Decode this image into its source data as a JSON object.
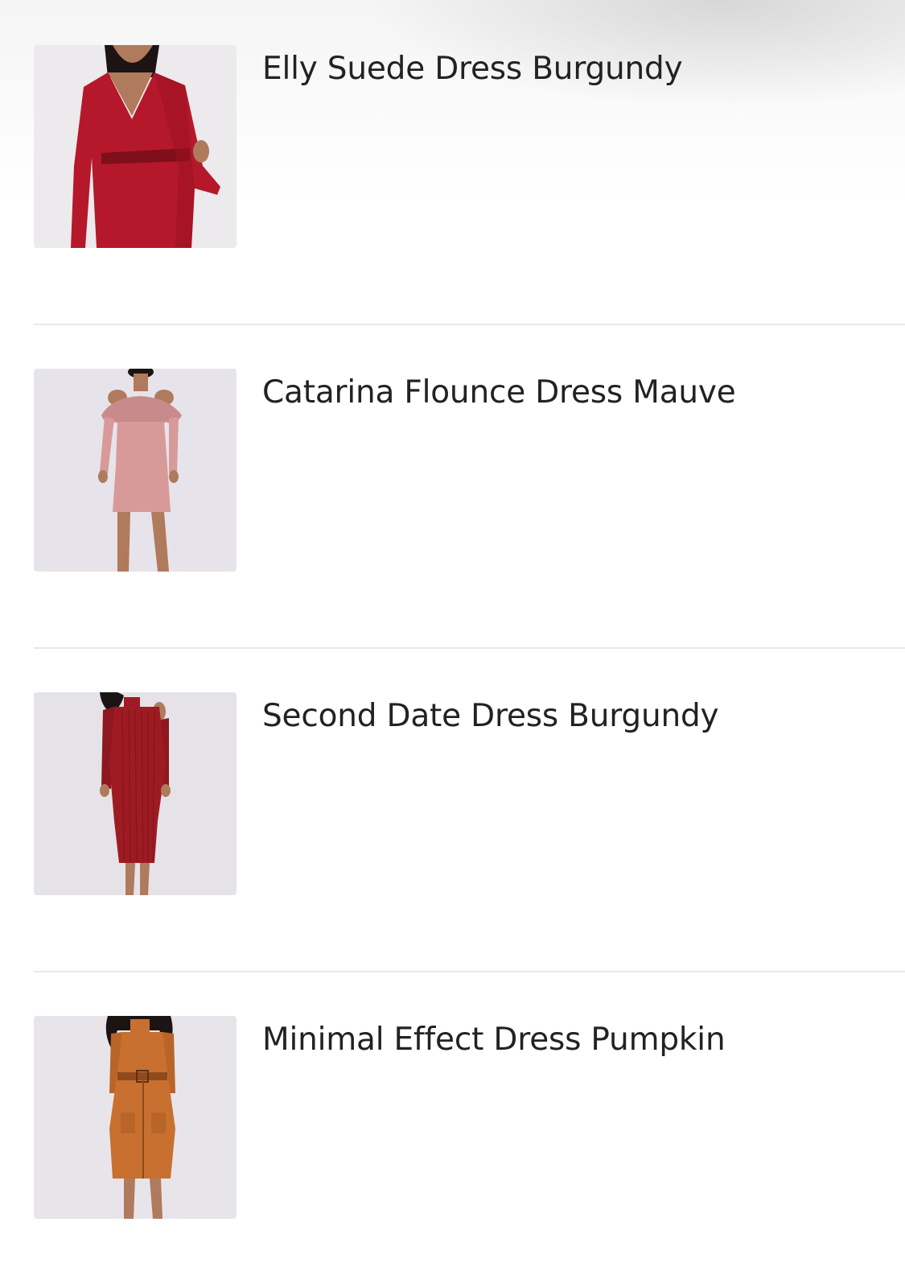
{
  "products": [
    {
      "name": "Elly Suede Dress Burgundy",
      "image_icon": "dress-photo-burgundy-suede",
      "color": "#b5182a"
    },
    {
      "name": "Catarina Flounce Dress Mauve",
      "image_icon": "dress-photo-mauve-flounce",
      "color": "#d79a99"
    },
    {
      "name": "Second Date Dress Burgundy",
      "image_icon": "dress-photo-burgundy-ribbed",
      "color": "#9e1b23"
    },
    {
      "name": "Minimal Effect Dress Pumpkin",
      "image_icon": "dress-photo-pumpkin",
      "color": "#c8702f"
    }
  ],
  "colors": {
    "background": "#ffffff",
    "title_text": "#222222",
    "divider": "#e7e7e7",
    "photo_backdrop": "#e9e6ea",
    "skin": "#b07a5d",
    "hair": "#1c1412"
  }
}
